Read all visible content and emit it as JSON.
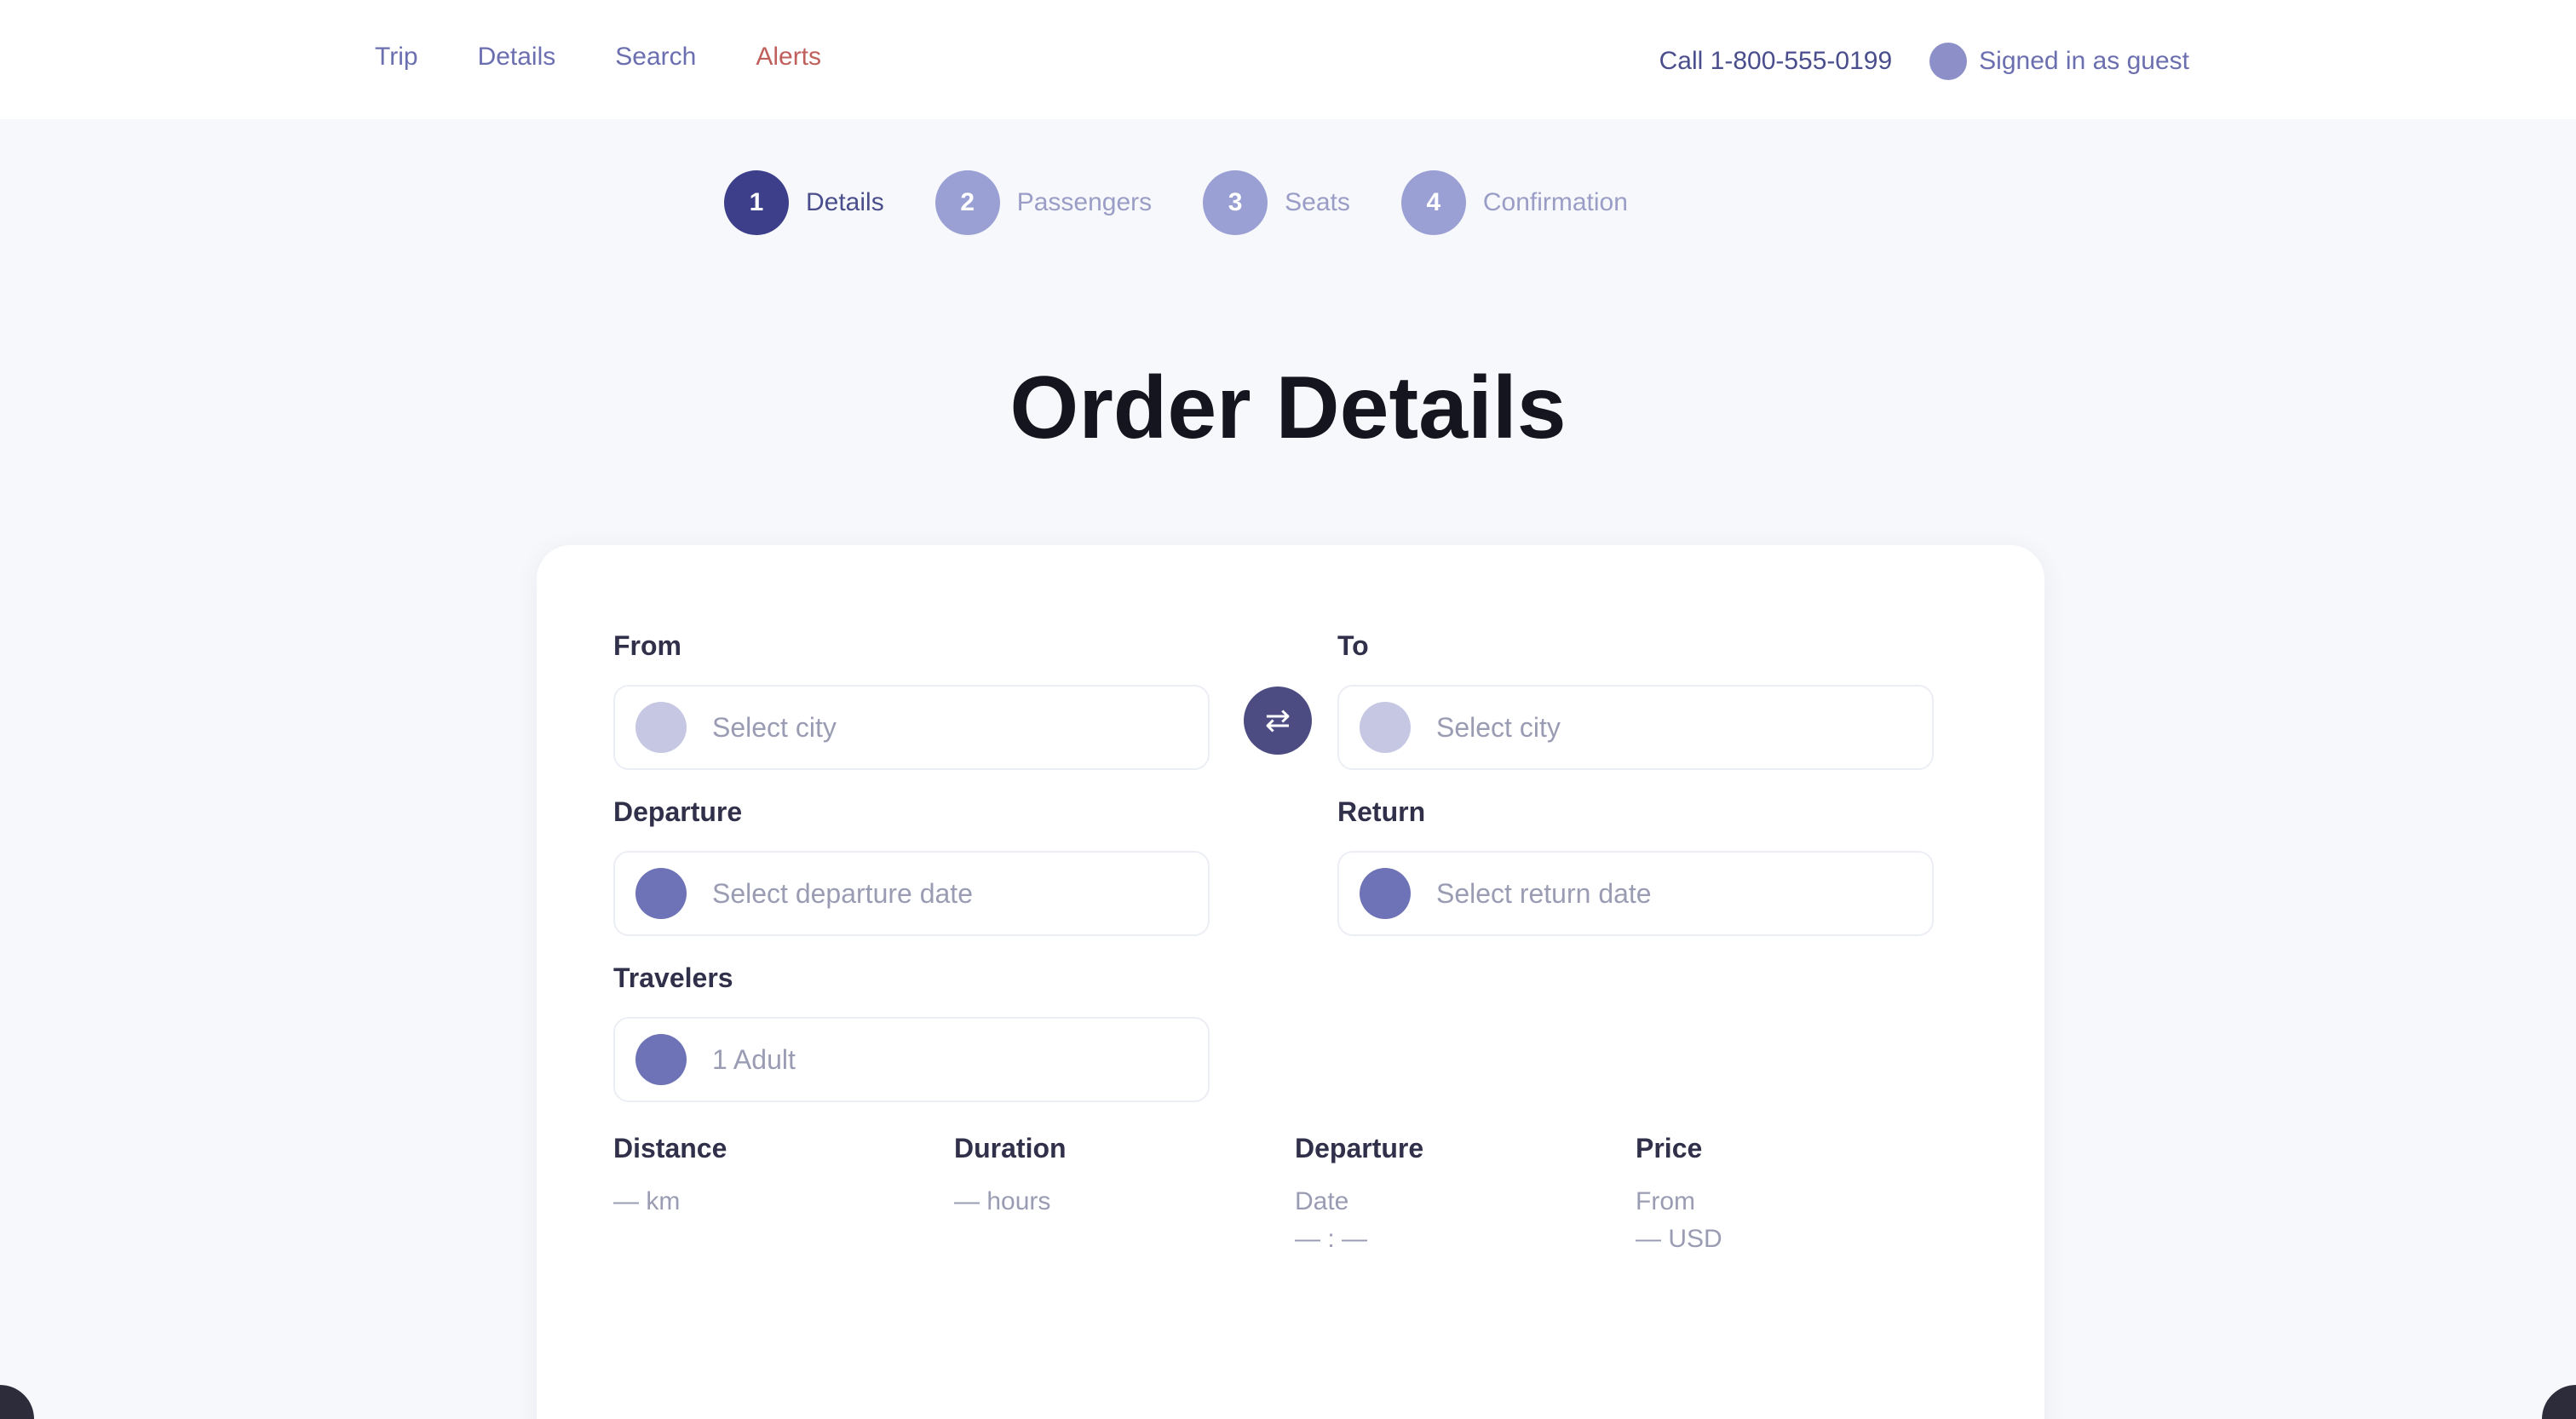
{
  "nav": {
    "links": [
      "Trip",
      "Details",
      "Search",
      "Alerts"
    ],
    "contact": "Call 1-800-555-0199",
    "account": "Signed in as guest"
  },
  "stepper": {
    "steps": [
      {
        "number": "1",
        "label": "Details"
      },
      {
        "number": "2",
        "label": "Passengers"
      },
      {
        "number": "3",
        "label": "Seats"
      },
      {
        "number": "4",
        "label": "Confirmation"
      }
    ]
  },
  "title": "Order Details",
  "form": {
    "from": {
      "label": "From",
      "value": "Select city"
    },
    "to": {
      "label": "To",
      "value": "Select city"
    },
    "swap_icon": "swap-icon",
    "departure": {
      "label": "Departure",
      "value": "Select departure date"
    },
    "return": {
      "label": "Return",
      "value": "Select return date"
    },
    "passengers": {
      "label": "Travelers",
      "value": "1 Adult"
    }
  },
  "summary": [
    {
      "head": "Distance",
      "lines": [
        "— km"
      ]
    },
    {
      "head": "Duration",
      "lines": [
        "— hours"
      ]
    },
    {
      "head": "Departure",
      "lines": [
        "Date",
        "— : —"
      ]
    },
    {
      "head": "Price",
      "lines": [
        "From",
        "— USD"
      ]
    }
  ]
}
